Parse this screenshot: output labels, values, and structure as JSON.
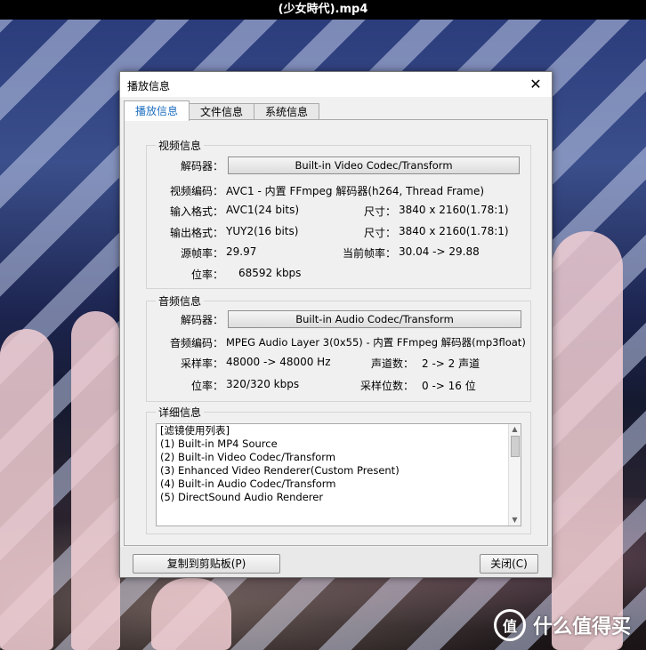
{
  "window": {
    "title": "(少女時代).mp4"
  },
  "watermark": {
    "logo_glyph": "值",
    "text": "什么值得买"
  },
  "dialog": {
    "title": "播放信息",
    "close_glyph": "✕",
    "tabs": [
      "播放信息",
      "文件信息",
      "系统信息"
    ],
    "video": {
      "group_title": "视频信息",
      "decoder_label": "解码器：",
      "decoder_button": "Built-in Video Codec/Transform",
      "codec_label": "视频编码：",
      "codec_value": "AVC1 - 内置 FFmpeg 解码器(h264, Thread Frame)",
      "input_label": "输入格式：",
      "input_value": "AVC1(24 bits)",
      "input_size_label": "尺寸：",
      "input_size_value": "3840 x 2160(1.78:1)",
      "output_label": "输出格式：",
      "output_value": "YUY2(16 bits)",
      "output_size_label": "尺寸：",
      "output_size_value": "3840 x 2160(1.78:1)",
      "src_fps_label": "源帧率：",
      "src_fps_value": "29.97",
      "cur_fps_label": "当前帧率：",
      "cur_fps_value": "30.04 -> 29.88",
      "bitrate_label": "位率：",
      "bitrate_value": "68592 kbps"
    },
    "audio": {
      "group_title": "音频信息",
      "decoder_label": "解码器：",
      "decoder_button": "Built-in Audio Codec/Transform",
      "codec_label": "音频编码：",
      "codec_value": "MPEG Audio Layer 3(0x55) - 内置 FFmpeg 解码器(mp3float)",
      "samplerate_label": "采样率：",
      "samplerate_value": "48000 -> 48000 Hz",
      "channels_label": "声道数：",
      "channels_value": "2 -> 2 声道",
      "bitrate_label": "位率：",
      "bitrate_value": "320/320 kbps",
      "bits_label": "采样位数：",
      "bits_value": "0 -> 16 位"
    },
    "details": {
      "group_title": "详细信息",
      "lines": [
        "[滤镜使用列表]",
        "(1) Built-in MP4 Source",
        "(2) Built-in Video Codec/Transform",
        "(3) Enhanced Video Renderer(Custom Present)",
        "(4) Built-in Audio Codec/Transform",
        "(5) DirectSound Audio Renderer"
      ]
    },
    "copy_button": "复制到剪贴板(P)",
    "close_button": "关闭(C)"
  }
}
